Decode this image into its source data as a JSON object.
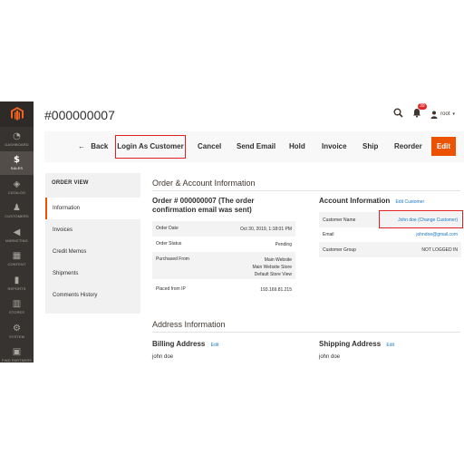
{
  "sidebar": {
    "items": [
      {
        "label": "DASHBOARD",
        "icon": "dashboard-icon"
      },
      {
        "label": "SALES",
        "icon": "dollar-icon"
      },
      {
        "label": "CATALOG",
        "icon": "cube-icon"
      },
      {
        "label": "CUSTOMERS",
        "icon": "person-icon"
      },
      {
        "label": "MARKETING",
        "icon": "megaphone-icon"
      },
      {
        "label": "CONTENT",
        "icon": "content-icon"
      },
      {
        "label": "REPORTS",
        "icon": "bar-chart-icon"
      },
      {
        "label": "STORES",
        "icon": "store-icon"
      },
      {
        "label": "SYSTEM",
        "icon": "gear-icon"
      },
      {
        "label": "FIND PARTNERS",
        "icon": "partners-icon"
      }
    ],
    "active_color": "#524d49"
  },
  "header": {
    "title": "#000000007",
    "notification_count": "39",
    "user": "root"
  },
  "toolbar": {
    "back": "Back",
    "login_as_customer": "Login As Customer",
    "cancel": "Cancel",
    "send_email": "Send Email",
    "hold": "Hold",
    "invoice": "Invoice",
    "ship": "Ship",
    "reorder": "Reorder",
    "edit": "Edit",
    "accent_color": "#eb5202"
  },
  "order_view": {
    "title": "ORDER VIEW",
    "tabs": [
      "Information",
      "Invoices",
      "Credit Memos",
      "Shipments",
      "Comments History"
    ]
  },
  "order_account": {
    "section_title": "Order & Account Information",
    "order_heading": "Order # 000000007 (The order confirmation email was sent)",
    "rows": [
      {
        "label": "Order Date",
        "value": "Oct 30, 2019, 1:18:01 PM"
      },
      {
        "label": "Order Status",
        "value": "Pending"
      },
      {
        "label": "Purchased From",
        "value_lines": [
          "Main Website",
          "Main Website Store",
          "Default Store View"
        ]
      },
      {
        "label": "Placed from IP",
        "value": "193.169.81.215"
      }
    ]
  },
  "account_info": {
    "heading": "Account Information",
    "edit_link": "Edit Customer",
    "rows": [
      {
        "label": "Customer Name",
        "value": "John doe (Change Customer)"
      },
      {
        "label": "Email",
        "value": "johndoe@gmail.com"
      },
      {
        "label": "Customer Group",
        "value": "NOT LOGGED IN"
      }
    ]
  },
  "address": {
    "section_title": "Address Information",
    "billing_heading": "Billing Address",
    "billing_edit": "Edit",
    "billing_name": "john doe",
    "shipping_heading": "Shipping Address",
    "shipping_edit": "Edit",
    "shipping_name": "john doe"
  }
}
